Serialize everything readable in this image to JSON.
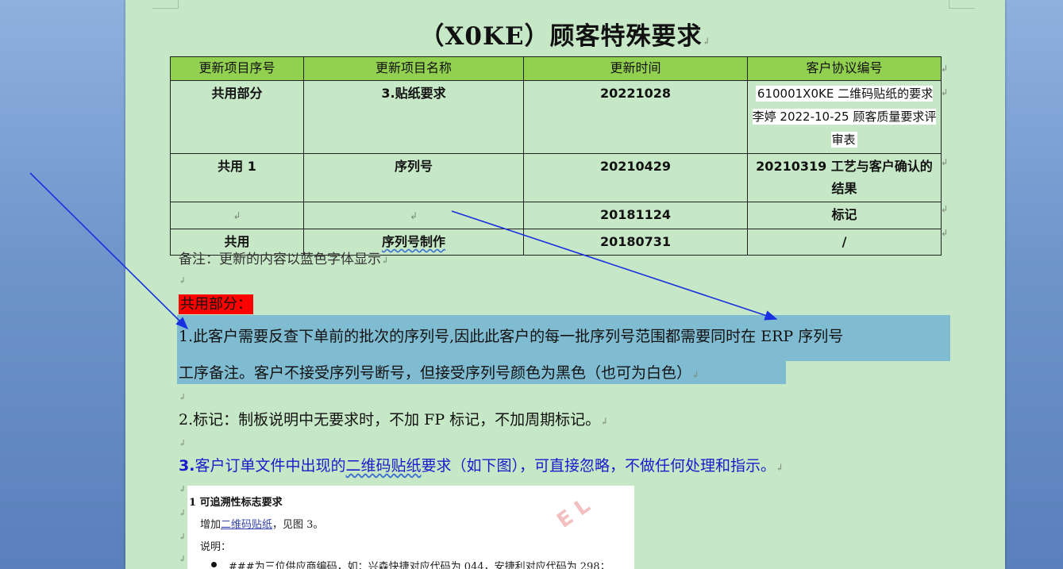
{
  "document": {
    "title": "（X0KE）顾客特殊要求",
    "paragraph_mark": "↲",
    "table": {
      "headers": [
        "更新项目序号",
        "更新项目名称",
        "更新时间",
        "客户协议编号"
      ],
      "rows": [
        {
          "seq": "共用部分",
          "name": "3.贴纸要求",
          "date": "20221028",
          "agreement": "610001X0KE 二维码贴纸的要求李婷 2022-10-25 顾客质量要求评审表"
        },
        {
          "seq": "共用 1",
          "name": "序列号",
          "date": "20210429",
          "agreement": "20210319 工艺与客户确认的结果"
        },
        {
          "seq": "",
          "name": "",
          "date": "20181124",
          "agreement": "标记"
        },
        {
          "seq": "共用",
          "name": "序列号制作",
          "date": "20180731",
          "agreement": "/"
        }
      ]
    },
    "note": "备注：更新的内容以蓝色字体显示",
    "shared_heading": "共用部分：",
    "item1_line1": "1.此客户需要反查下单前的批次的序列号,因此此客户的每一批序列号范围都需要同时在 ERP 序列号",
    "item1_line2": "工序备注。客户不接受序列号断号，但接受序列号颜色为黑色（也可为白色）",
    "item2": "2.标记：制板说明中无要求时，不加 FP 标记，不加周期标记。",
    "item3": {
      "num": "3.",
      "pre": "客户订单文件中出现的",
      "link": "二维码贴纸",
      "post": "要求（如下图），可直接忽略，不做任何处理和指示。"
    },
    "embedded_image": {
      "heading": "1 可追溯性标志要求",
      "line1_pre": "增加",
      "line1_link": "二维码贴纸",
      "line1_post": "，见图 3。",
      "line2": "说明：",
      "line3": "###为三位供应商编码，如：兴森快捷对应代码为 044，安捷利对应代码为 298；",
      "stamp": "E L"
    }
  },
  "colors": {
    "page_background": "#c7e8c7",
    "table_header": "#92d050",
    "highlight_red": "#ff0000",
    "selection": "#7fbcd2",
    "blue_text": "#1a1acc",
    "arrow": "#1a2fe0"
  }
}
